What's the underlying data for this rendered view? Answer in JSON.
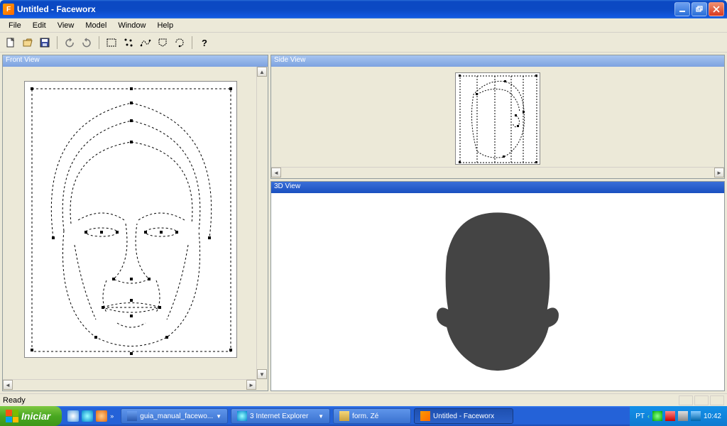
{
  "titlebar": {
    "title": "Untitled - Faceworx"
  },
  "menu": {
    "items": [
      "File",
      "Edit",
      "View",
      "Model",
      "Window",
      "Help"
    ]
  },
  "toolbar": {
    "groups": [
      [
        "new-file-icon",
        "open-file-icon",
        "save-file-icon"
      ],
      [
        "undo-icon",
        "redo-icon"
      ],
      [
        "tool-rect-icon",
        "tool-points-icon",
        "tool-curve-icon",
        "tool-lasso-icon",
        "tool-lasso2-icon"
      ],
      [
        "help-icon"
      ]
    ]
  },
  "panels": {
    "front": {
      "title": "Front View"
    },
    "side": {
      "title": "Side View"
    },
    "threed": {
      "title": "3D View"
    }
  },
  "statusbar": {
    "text": "Ready"
  },
  "taskbar": {
    "start": "Iniciar",
    "tasks": [
      {
        "label": "guia_manual_facewo...",
        "icon": "word-icon",
        "chevron": true
      },
      {
        "label": "3 Internet Explorer",
        "icon": "ie-icon",
        "chevron": true
      },
      {
        "label": "form. Zé",
        "icon": "folder-icon",
        "chevron": false
      },
      {
        "label": "Untitled - Faceworx",
        "icon": "faceworx-icon",
        "chevron": false,
        "active": true
      }
    ],
    "lang": "PT",
    "clock": "10:42"
  }
}
